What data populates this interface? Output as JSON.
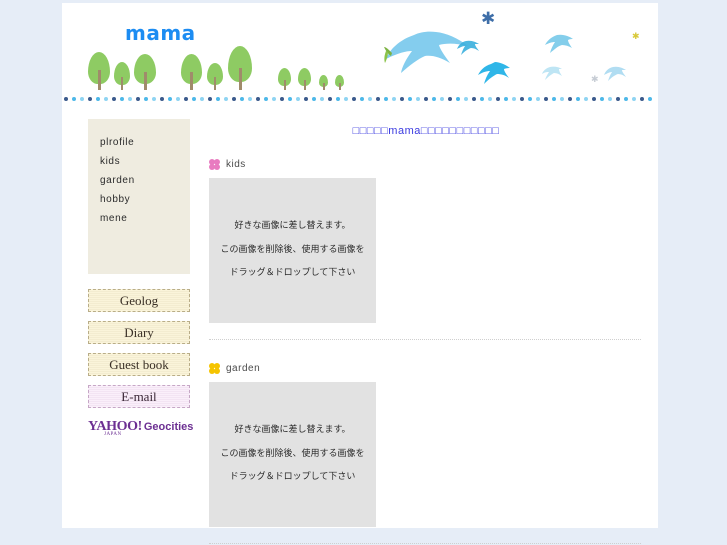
{
  "site": {
    "title": "mama",
    "title_color": "#1c8cf2",
    "background_color": "#e6edf7",
    "page_color": "#ffffff"
  },
  "banner": {
    "decorations": [
      {
        "name": "tree",
        "kind": "tree"
      },
      {
        "name": "swallow-bird-large",
        "kind": "bird"
      },
      {
        "name": "swallow-bird-small",
        "kind": "bird"
      },
      {
        "name": "snowflake-star",
        "kind": "star"
      }
    ],
    "divider_colors": [
      "#3b5a8c",
      "#4db8e8",
      "#8fd4f2"
    ]
  },
  "sidebar": {
    "nav_items": [
      {
        "label": "plrofile",
        "name": "sidebar-item-profile"
      },
      {
        "label": "kids",
        "name": "sidebar-item-kids"
      },
      {
        "label": "garden",
        "name": "sidebar-item-garden"
      },
      {
        "label": "hobby",
        "name": "sidebar-item-hobby"
      },
      {
        "label": "mene",
        "name": "sidebar-item-menu"
      }
    ],
    "buttons": [
      {
        "label": "Geolog",
        "name": "geolog-button",
        "style": "cream"
      },
      {
        "label": "Diary",
        "name": "diary-button",
        "style": "cream"
      },
      {
        "label": "Guest book",
        "name": "guest-book-button",
        "style": "cream"
      },
      {
        "label": "E-mail",
        "name": "email-button",
        "style": "pink"
      }
    ],
    "yahoo_logo": {
      "yahoo": "YAHOO!",
      "geocities": "Geocities",
      "japan": "JAPAN",
      "color": "#6c2f92"
    }
  },
  "main": {
    "heading": "□□□□□mama□□□□□□□□□□□",
    "sections": [
      {
        "label": "kids",
        "icon": "flower-icon",
        "icon_color": "#e87bc0",
        "photo": {
          "line1": "好きな画像に差し替えます。",
          "line2": "この画像を削除後、使用する画像を",
          "line3": "ドラッグ＆ドロップして下さい"
        }
      },
      {
        "label": "garden",
        "icon": "flower-icon",
        "icon_color": "#f5c400",
        "photo": {
          "line1": "好きな画像に差し替えます。",
          "line2": "この画像を削除後、使用する画像を",
          "line3": "ドラッグ＆ドロップして下さい"
        }
      }
    ]
  }
}
